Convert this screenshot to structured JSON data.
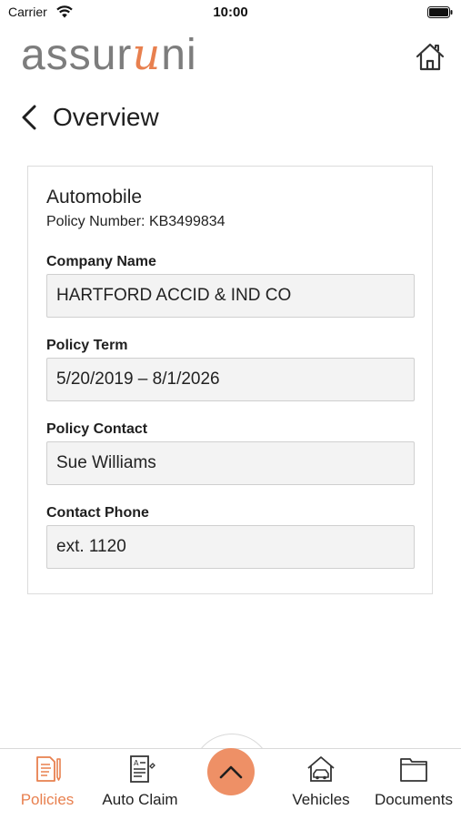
{
  "status_bar": {
    "carrier": "Carrier",
    "time": "10:00"
  },
  "header": {
    "logo_prefix": "assur",
    "logo_accent": "u",
    "logo_suffix": "ni",
    "home_icon": "home-icon"
  },
  "nav": {
    "back_icon": "chevron-left-icon",
    "title": "Overview"
  },
  "policy": {
    "type": "Automobile",
    "number_label": "Policy Number:",
    "number": "KB3499834",
    "fields": [
      {
        "label": "Company Name",
        "value": "HARTFORD ACCID & IND CO"
      },
      {
        "label": "Policy Term",
        "value": "5/20/2019 – 8/1/2026"
      },
      {
        "label": "Policy Contact",
        "value": "Sue Williams"
      },
      {
        "label": "Contact Phone",
        "value": "ext. 1120"
      }
    ]
  },
  "tabs": [
    {
      "label": "Policies",
      "icon": "policies-icon",
      "active": true
    },
    {
      "label": "Auto Claim",
      "icon": "auto-claim-icon",
      "active": false
    },
    {
      "label": "Vehicles",
      "icon": "vehicles-icon",
      "active": false
    },
    {
      "label": "Documents",
      "icon": "documents-icon",
      "active": false
    }
  ],
  "fab_icon": "chevron-up-icon",
  "colors": {
    "accent": "#e8804f",
    "fab": "#ee9066",
    "field_bg": "#f3f3f3",
    "logo_gray": "#7d7d7d"
  }
}
